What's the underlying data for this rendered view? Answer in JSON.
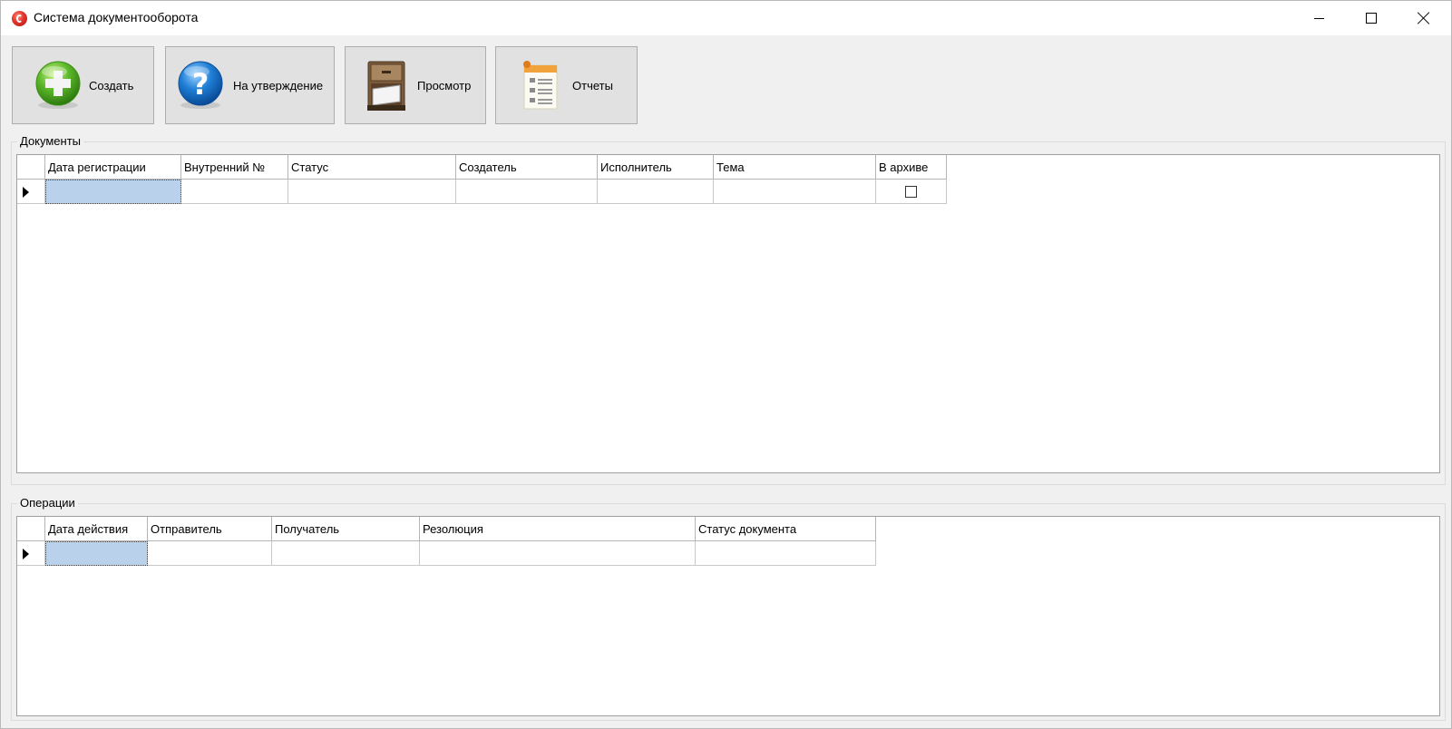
{
  "window": {
    "title": "Система документооборота",
    "app_icon": "app-logo-icon"
  },
  "toolbar": {
    "create": {
      "label": "Создать",
      "icon": "green-plus-icon"
    },
    "approve": {
      "label": "На утверждение",
      "icon": "blue-question-icon"
    },
    "view": {
      "label": "Просмотр",
      "icon": "file-cabinet-icon"
    },
    "reports": {
      "label": "Отчеты",
      "icon": "report-document-icon"
    }
  },
  "documents": {
    "title": "Документы",
    "columns": [
      "Дата регистрации",
      "Внутренний №",
      "Статус",
      "Создатель",
      "Исполнитель",
      "Тема",
      "В архиве"
    ],
    "rows": [
      {
        "date": "",
        "number": "",
        "status": "",
        "creator": "",
        "executor": "",
        "topic": "",
        "archived": false
      }
    ]
  },
  "operations": {
    "title": "Операции",
    "columns": [
      "Дата действия",
      "Отправитель",
      "Получатель",
      "Резолюция",
      "Статус документа"
    ],
    "rows": [
      {
        "date": "",
        "sender": "",
        "recipient": "",
        "resolution": "",
        "doc_status": ""
      }
    ]
  },
  "colors": {
    "selected_cell": "#b9d1ea",
    "button_face": "#e1e1e1",
    "window_bg": "#f0f0f0"
  }
}
